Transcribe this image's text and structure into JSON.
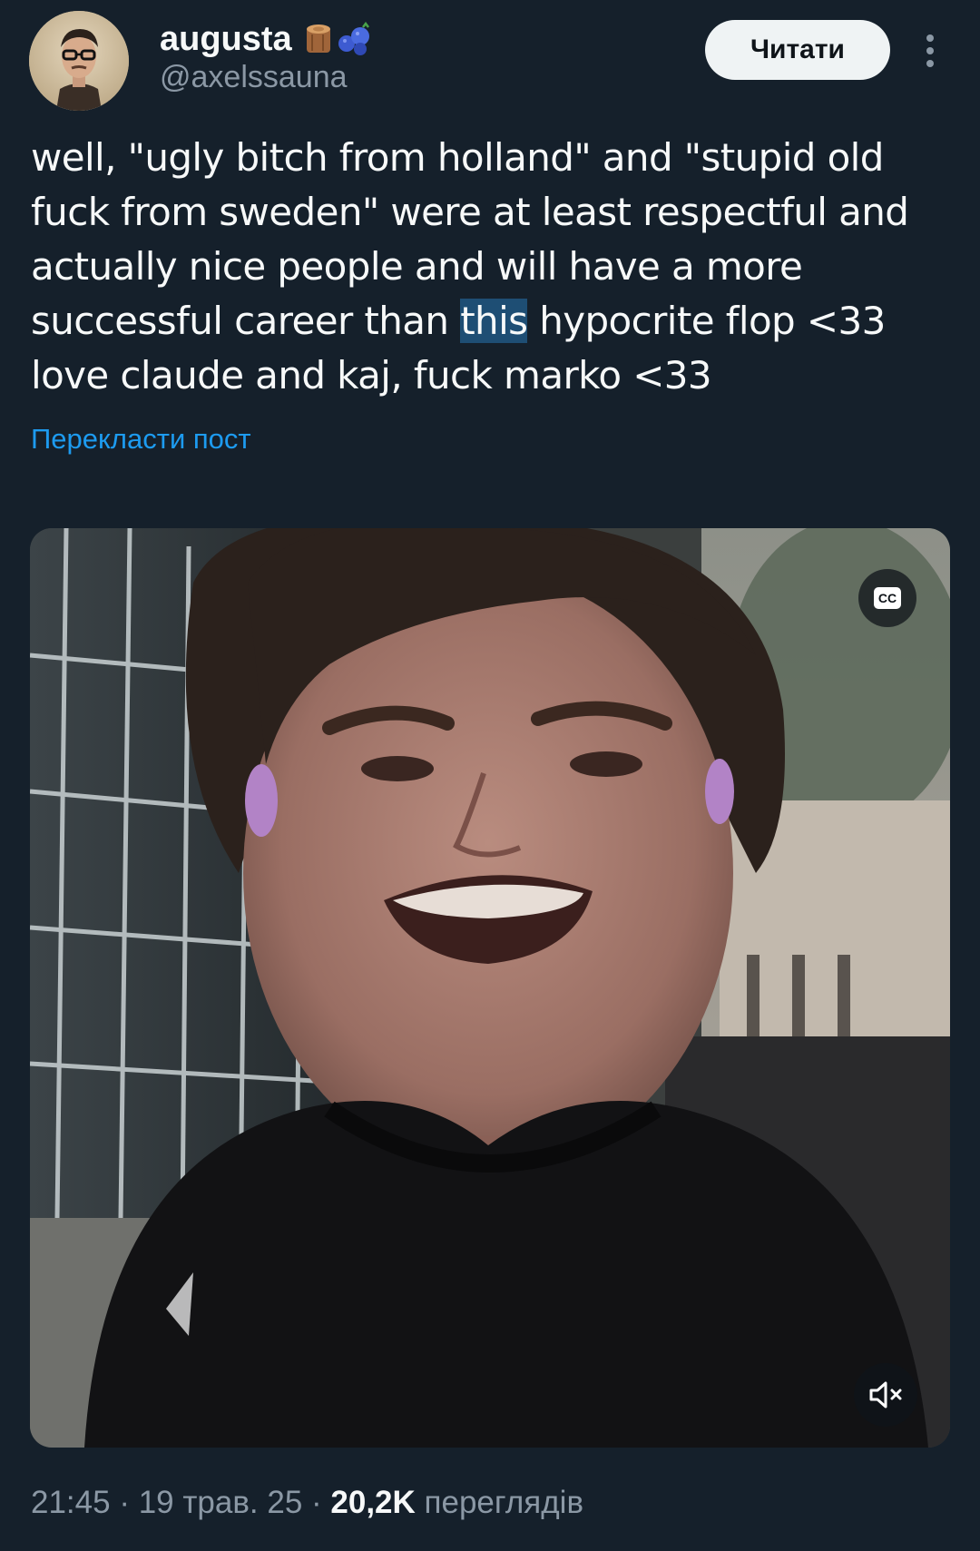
{
  "user": {
    "display_name": "augusta",
    "handle": "@axelssauna",
    "emojis": [
      "wood-log-icon",
      "blueberries-icon"
    ]
  },
  "follow_button": {
    "label": "Читати"
  },
  "more_icon": "more-vertical-icon",
  "tweet": {
    "text_before": "well, \"ugly bitch from holland\" and \"stupid old fuck from sweden\" were at least respectful and actually nice people and will have a more successful career than ",
    "text_highlight": "this",
    "text_after": " hypocrite flop <33 love claude and kaj, fuck marko <33",
    "translate_label": "Перекласти пост"
  },
  "media": {
    "type": "video",
    "cc_label": "CC",
    "cc_icon": "closed-captions-icon",
    "mute_icon": "volume-muted-icon"
  },
  "meta": {
    "time": "21:45",
    "sep1": " · ",
    "date": "19 трав. 25",
    "sep2": " · ",
    "views_count": "20,2K",
    "views_label": " переглядів"
  },
  "colors": {
    "background": "#15202b",
    "text": "#f7f9f9",
    "secondary": "#8b98a5",
    "link": "#1d9bf0",
    "highlight": "#1e4e74"
  }
}
